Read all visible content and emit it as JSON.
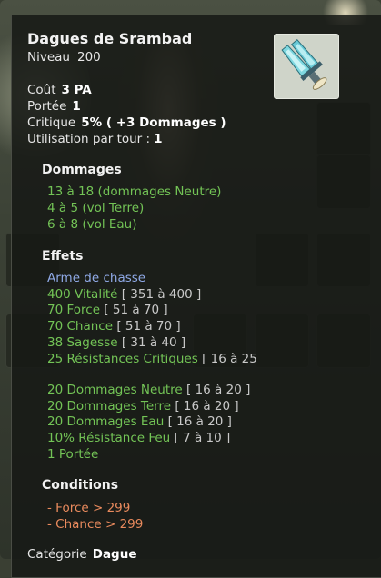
{
  "item": {
    "name": "Dagues de Srambad",
    "level_label": "Niveau",
    "level_value": "200"
  },
  "stats": {
    "cost_label": "Coût",
    "cost_value": "3 PA",
    "range_label": "Portée",
    "range_value": "1",
    "crit_label": "Critique",
    "crit_value": "5% ( +3 Dommages )",
    "uses_label": "Utilisation par tour :",
    "uses_value": "1"
  },
  "damage": {
    "title": "Dommages",
    "lines": [
      "13 à 18 (dommages Neutre)",
      "4 à 5 (vol Terre)",
      "6 à 8 (vol Eau)"
    ]
  },
  "effects": {
    "title": "Effets",
    "weapon_type": "Arme de chasse",
    "lines": [
      {
        "text": "400 Vitalité",
        "range": "[ 351 à 400 ]"
      },
      {
        "text": "70 Force",
        "range": "[ 51 à 70 ]"
      },
      {
        "text": "70 Chance",
        "range": "[ 51 à 70 ]"
      },
      {
        "text": "38 Sagesse",
        "range": "[ 31 à 40 ]"
      },
      {
        "text": "25 Résistances Critiques",
        "range": "[ 16 à 25"
      },
      {
        "text": "20 Dommages Neutre",
        "range": "[ 16 à 20 ]"
      },
      {
        "text": "20 Dommages Terre",
        "range": "[ 16 à 20 ]"
      },
      {
        "text": "20 Dommages Eau",
        "range": "[ 16 à 20 ]"
      },
      {
        "text": "10% Résistance Feu",
        "range": "[ 7 à 10 ]"
      },
      {
        "text": "1 Portée",
        "range": ""
      }
    ]
  },
  "conditions": {
    "title": "Conditions",
    "lines": [
      "- Force > 299",
      "- Chance > 299"
    ]
  },
  "category": {
    "label": "Catégorie",
    "value": "Dague"
  },
  "icon": "crystal-daggers-icon",
  "colors": {
    "bonus_green": "#73c456",
    "weapon_type_blue": "#8fa9e6",
    "condition_orange": "#e98a5d"
  }
}
